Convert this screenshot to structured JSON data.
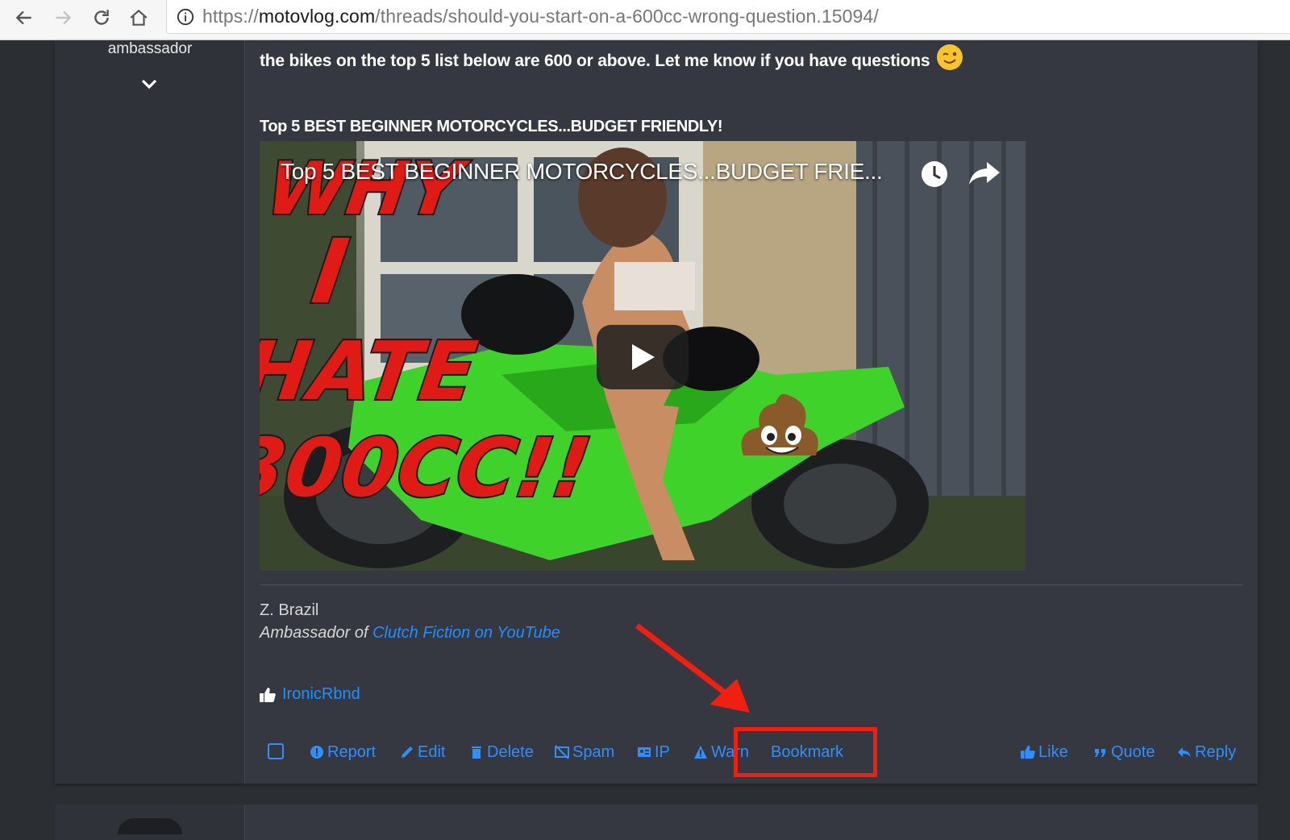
{
  "browser": {
    "url_scheme": "https://",
    "url_host": "motovlog.com",
    "url_path": "/threads/should-you-start-on-a-600cc-wrong-question.15094/"
  },
  "sidebar": {
    "role": "ambassador"
  },
  "post": {
    "message_tail": "the bikes on the top 5 list below are 600 or above. Let me know if you have questions",
    "video_heading": "Top 5 BEST BEGINNER MOTORCYCLES...BUDGET FRIENDLY!",
    "video": {
      "overlay_title": "Top 5 BEST BEGINNER MOTORCYCLES...BUDGET FRIE...",
      "thumbnail_caption": "WHY I HATE 300CC!!"
    },
    "signature": {
      "name": "Z. Brazil",
      "prefix": "Ambassador of ",
      "link": "Clutch Fiction on YouTube"
    },
    "liked_by": "IronicRbnd",
    "actions": {
      "report": "Report",
      "edit": "Edit",
      "delete": "Delete",
      "spam": "Spam",
      "ip": "IP",
      "warn": "Warn",
      "bookmark": "Bookmark",
      "like": "Like",
      "quote": "Quote",
      "reply": "Reply"
    }
  },
  "colors": {
    "link": "#2f8fff",
    "panel": "#353840",
    "annotation": "#f01f10"
  }
}
